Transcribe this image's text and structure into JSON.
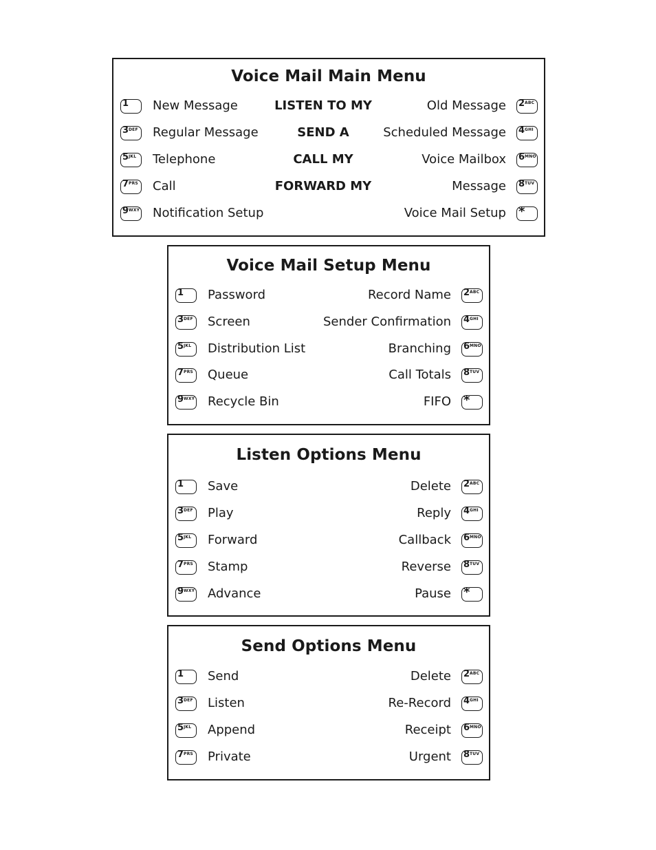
{
  "menus": {
    "main": {
      "title": "Voice Mail Main Menu",
      "rows": [
        {
          "left_key": {
            "digit": "1",
            "letters": ""
          },
          "left_label": "New Message",
          "center": "LISTEN TO MY",
          "right_label": "Old Message",
          "right_key": {
            "digit": "2",
            "letters": "ABC"
          }
        },
        {
          "left_key": {
            "digit": "3",
            "letters": "DEF"
          },
          "left_label": "Regular Message",
          "center": "SEND A",
          "right_label": "Scheduled Message",
          "right_key": {
            "digit": "4",
            "letters": "GHI"
          }
        },
        {
          "left_key": {
            "digit": "5",
            "letters": "JKL"
          },
          "left_label": "Telephone",
          "center": "CALL MY",
          "right_label": "Voice Mailbox",
          "right_key": {
            "digit": "6",
            "letters": "MNO"
          }
        },
        {
          "left_key": {
            "digit": "7",
            "letters": "PRS"
          },
          "left_label": "Call",
          "center": "FORWARD MY",
          "right_label": "Message",
          "right_key": {
            "digit": "8",
            "letters": "TUV"
          }
        },
        {
          "left_key": {
            "digit": "9",
            "letters": "WXY"
          },
          "left_label": "Notification Setup",
          "center": "",
          "right_label": "Voice Mail Setup",
          "right_key": {
            "digit": "*",
            "letters": ""
          }
        }
      ]
    },
    "setup": {
      "title": "Voice Mail Setup Menu",
      "rows": [
        {
          "left_key": {
            "digit": "1",
            "letters": ""
          },
          "left_label": "Password",
          "right_label": "Record Name",
          "right_key": {
            "digit": "2",
            "letters": "ABC"
          }
        },
        {
          "left_key": {
            "digit": "3",
            "letters": "DEF"
          },
          "left_label": "Screen",
          "right_label": "Sender Confirmation",
          "right_key": {
            "digit": "4",
            "letters": "GHI"
          }
        },
        {
          "left_key": {
            "digit": "5",
            "letters": "JKL"
          },
          "left_label": "Distribution List",
          "right_label": "Branching",
          "right_key": {
            "digit": "6",
            "letters": "MNO"
          }
        },
        {
          "left_key": {
            "digit": "7",
            "letters": "PRS"
          },
          "left_label": "Queue",
          "right_label": "Call Totals",
          "right_key": {
            "digit": "8",
            "letters": "TUV"
          }
        },
        {
          "left_key": {
            "digit": "9",
            "letters": "WXY"
          },
          "left_label": "Recycle Bin",
          "right_label": "FIFO",
          "right_key": {
            "digit": "*",
            "letters": ""
          }
        }
      ]
    },
    "listen": {
      "title": "Listen Options Menu",
      "rows": [
        {
          "left_key": {
            "digit": "1",
            "letters": ""
          },
          "left_label": "Save",
          "right_label": "Delete",
          "right_key": {
            "digit": "2",
            "letters": "ABC"
          }
        },
        {
          "left_key": {
            "digit": "3",
            "letters": "DEF"
          },
          "left_label": "Play",
          "right_label": "Reply",
          "right_key": {
            "digit": "4",
            "letters": "GHI"
          }
        },
        {
          "left_key": {
            "digit": "5",
            "letters": "JKL"
          },
          "left_label": "Forward",
          "right_label": "Callback",
          "right_key": {
            "digit": "6",
            "letters": "MNO"
          }
        },
        {
          "left_key": {
            "digit": "7",
            "letters": "PRS"
          },
          "left_label": "Stamp",
          "right_label": "Reverse",
          "right_key": {
            "digit": "8",
            "letters": "TUV"
          }
        },
        {
          "left_key": {
            "digit": "9",
            "letters": "WXY"
          },
          "left_label": "Advance",
          "right_label": "Pause",
          "right_key": {
            "digit": "*",
            "letters": ""
          }
        }
      ]
    },
    "send": {
      "title": "Send Options Menu",
      "rows": [
        {
          "left_key": {
            "digit": "1",
            "letters": ""
          },
          "left_label": "Send",
          "right_label": "Delete",
          "right_key": {
            "digit": "2",
            "letters": "ABC"
          }
        },
        {
          "left_key": {
            "digit": "3",
            "letters": "DEF"
          },
          "left_label": "Listen",
          "right_label": "Re-Record",
          "right_key": {
            "digit": "4",
            "letters": "GHI"
          }
        },
        {
          "left_key": {
            "digit": "5",
            "letters": "JKL"
          },
          "left_label": "Append",
          "right_label": "Receipt",
          "right_key": {
            "digit": "6",
            "letters": "MNO"
          }
        },
        {
          "left_key": {
            "digit": "7",
            "letters": "PRS"
          },
          "left_label": "Private",
          "right_label": "Urgent",
          "right_key": {
            "digit": "8",
            "letters": "TUV"
          }
        }
      ]
    }
  }
}
